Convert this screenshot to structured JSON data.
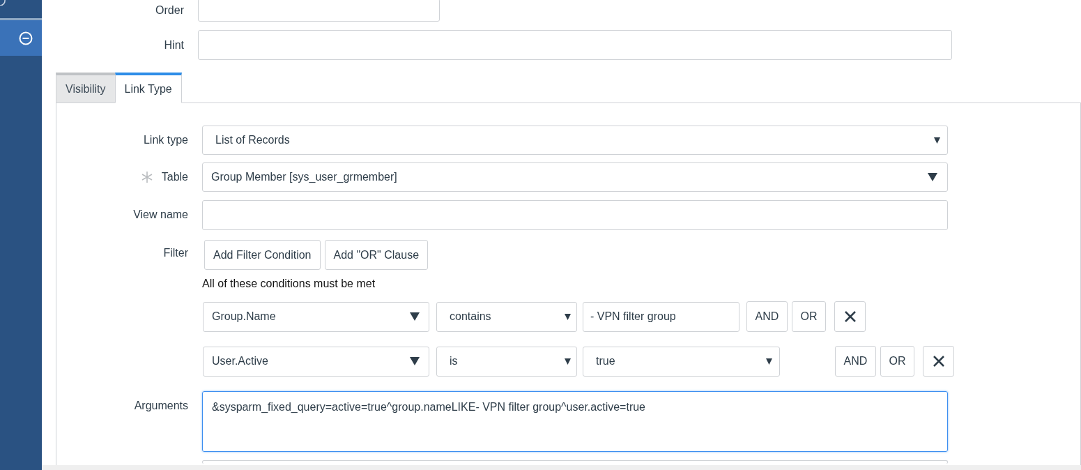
{
  "top_fields": [
    {
      "label": "Order",
      "wide": false
    },
    {
      "label": "Hint",
      "wide": true
    }
  ],
  "tabs": [
    {
      "label": "Visibility",
      "selected": false
    },
    {
      "label": "Link Type",
      "selected": true
    }
  ],
  "link_type": {
    "label": "Link type",
    "value": "List of Records"
  },
  "table": {
    "label": "Table",
    "value": "Group Member [sys_user_grmember]",
    "mandatory": true
  },
  "view_name": {
    "label": "View name"
  },
  "filter": {
    "label": "Filter",
    "buttons": [
      "Add Filter Condition",
      "Add \"OR\" Clause"
    ],
    "note": "All of these conditions must be met",
    "conditions": [
      {
        "field": "Group.Name",
        "operator": "contains",
        "value": "- VPN filter group",
        "kind": "text",
        "and": "AND",
        "or": "OR"
      },
      {
        "field": "User.Active",
        "operator": "is",
        "value": "true",
        "kind": "select",
        "and": "AND",
        "or": "OR"
      }
    ]
  },
  "arguments": {
    "label": "Arguments",
    "value": "&sysparm_fixed_query=active=true^group.nameLIKE- VPN filter group^user.active=true",
    "focused": true
  }
}
